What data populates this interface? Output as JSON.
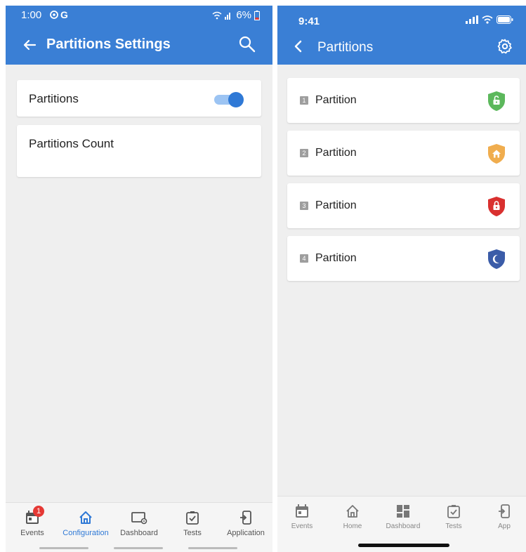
{
  "left": {
    "status": {
      "time": "1:00",
      "battery": "6%"
    },
    "appbar": {
      "title": "Partitions Settings"
    },
    "rows": [
      {
        "label": "Partitions",
        "toggle_on": true
      },
      {
        "label": "Partitions Count"
      }
    ],
    "nav": {
      "items": [
        {
          "label": "Events",
          "icon": "calendar-icon",
          "badge": "1"
        },
        {
          "label": "Configuration",
          "icon": "home-icon",
          "active": true
        },
        {
          "label": "Dashboard",
          "icon": "dashboard-settings-icon"
        },
        {
          "label": "Tests",
          "icon": "checkbox-icon"
        },
        {
          "label": "Application",
          "icon": "app-icon"
        }
      ]
    },
    "colors": {
      "primary": "#3a7fd5",
      "accent": "#2f79d6",
      "background": "#efefef"
    }
  },
  "right": {
    "status": {
      "time": "9:41"
    },
    "header": {
      "title": "Partitions"
    },
    "partitions": [
      {
        "number": "1",
        "label": "Partition",
        "status_icon": "unlocked-shield-icon",
        "color": "#5cb85c"
      },
      {
        "number": "2",
        "label": "Partition",
        "status_icon": "home-shield-icon",
        "color": "#f0ad4e"
      },
      {
        "number": "3",
        "label": "Partition",
        "status_icon": "locked-shield-icon",
        "color": "#d9302f"
      },
      {
        "number": "4",
        "label": "Partition",
        "status_icon": "night-shield-icon",
        "color": "#3b5ca8"
      }
    ],
    "nav": {
      "items": [
        {
          "label": "Events",
          "icon": "calendar-icon"
        },
        {
          "label": "Home",
          "icon": "home-icon"
        },
        {
          "label": "Dashboard",
          "icon": "dashboard-icon"
        },
        {
          "label": "Tests",
          "icon": "checkbox-icon"
        },
        {
          "label": "App",
          "icon": "app-icon"
        }
      ]
    }
  }
}
